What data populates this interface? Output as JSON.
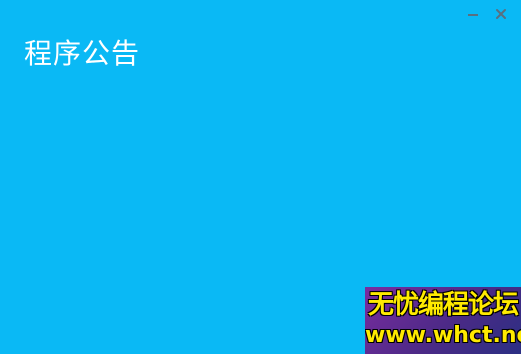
{
  "window": {
    "title": "程序公告",
    "background_color": "#0ab9f5"
  },
  "controls": {
    "minimize_icon": "minimize-icon",
    "close_icon": "close-icon",
    "icon_color": "#5a6f80"
  },
  "watermark": {
    "line1": "无忧编程论坛",
    "line2": "www.whct.net"
  }
}
